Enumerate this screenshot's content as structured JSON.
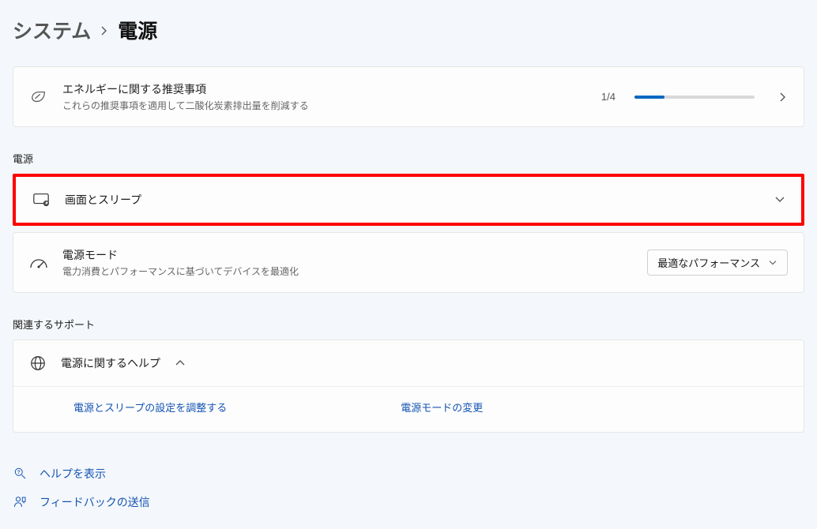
{
  "breadcrumb": {
    "parent": "システム",
    "current": "電源"
  },
  "energy": {
    "title": "エネルギーに関する推奨事項",
    "subtitle": "これらの推奨事項を適用して二酸化炭素排出量を削減する",
    "counter": "1/4",
    "progress_percent": 25
  },
  "sections": {
    "power_label": "電源",
    "screen_sleep": {
      "title": "画面とスリープ"
    },
    "power_mode": {
      "title": "電源モード",
      "subtitle": "電力消費とパフォーマンスに基づいてデバイスを最適化",
      "selected": "最適なパフォーマンス"
    },
    "support_label": "関連するサポート",
    "power_help": {
      "title": "電源に関するヘルプ",
      "link_sleep": "電源とスリープの設定を調整する",
      "link_mode": "電源モードの変更"
    }
  },
  "footer": {
    "help": "ヘルプを表示",
    "feedback": "フィードバックの送信"
  }
}
